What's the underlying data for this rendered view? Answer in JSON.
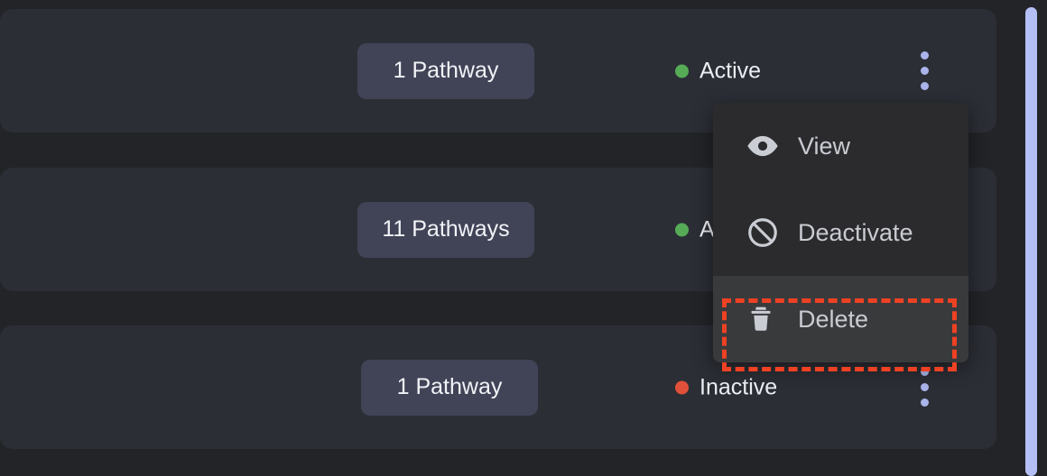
{
  "theme": {
    "page_background": "#232428",
    "row_background": "#2b2e35",
    "pill_background": "#414457",
    "menu_background": "#2b2b2e",
    "menu_highlight_background": "#393a3c",
    "accent_scrollbar": "#b4c0f5",
    "accent_kebab": "#aab4ea",
    "status_active_color": "#55ab56",
    "status_inactive_color": "#e1503a",
    "focus_ring_color": "#ef4123"
  },
  "rows": [
    {
      "pathways_label": "1 Pathway",
      "status_label": "Active",
      "status_color": "#55ab56",
      "menu_icon": "kebab-menu-icon"
    },
    {
      "pathways_label": "11 Pathways",
      "status_label": "Active",
      "status_color": "#55ab56",
      "menu_icon": "kebab-menu-icon"
    },
    {
      "pathways_label": "1 Pathway",
      "status_label": "Inactive",
      "status_color": "#e1503a",
      "menu_icon": "kebab-menu-icon"
    }
  ],
  "context_menu": {
    "items": [
      {
        "label": "View",
        "icon": "eye-icon",
        "highlighted": false
      },
      {
        "label": "Deactivate",
        "icon": "slash-circle-icon",
        "highlighted": false
      },
      {
        "label": "Delete",
        "icon": "trash-icon",
        "highlighted": true
      }
    ]
  },
  "scrollbar": {
    "icon": "vertical-scrollbar-thumb"
  }
}
